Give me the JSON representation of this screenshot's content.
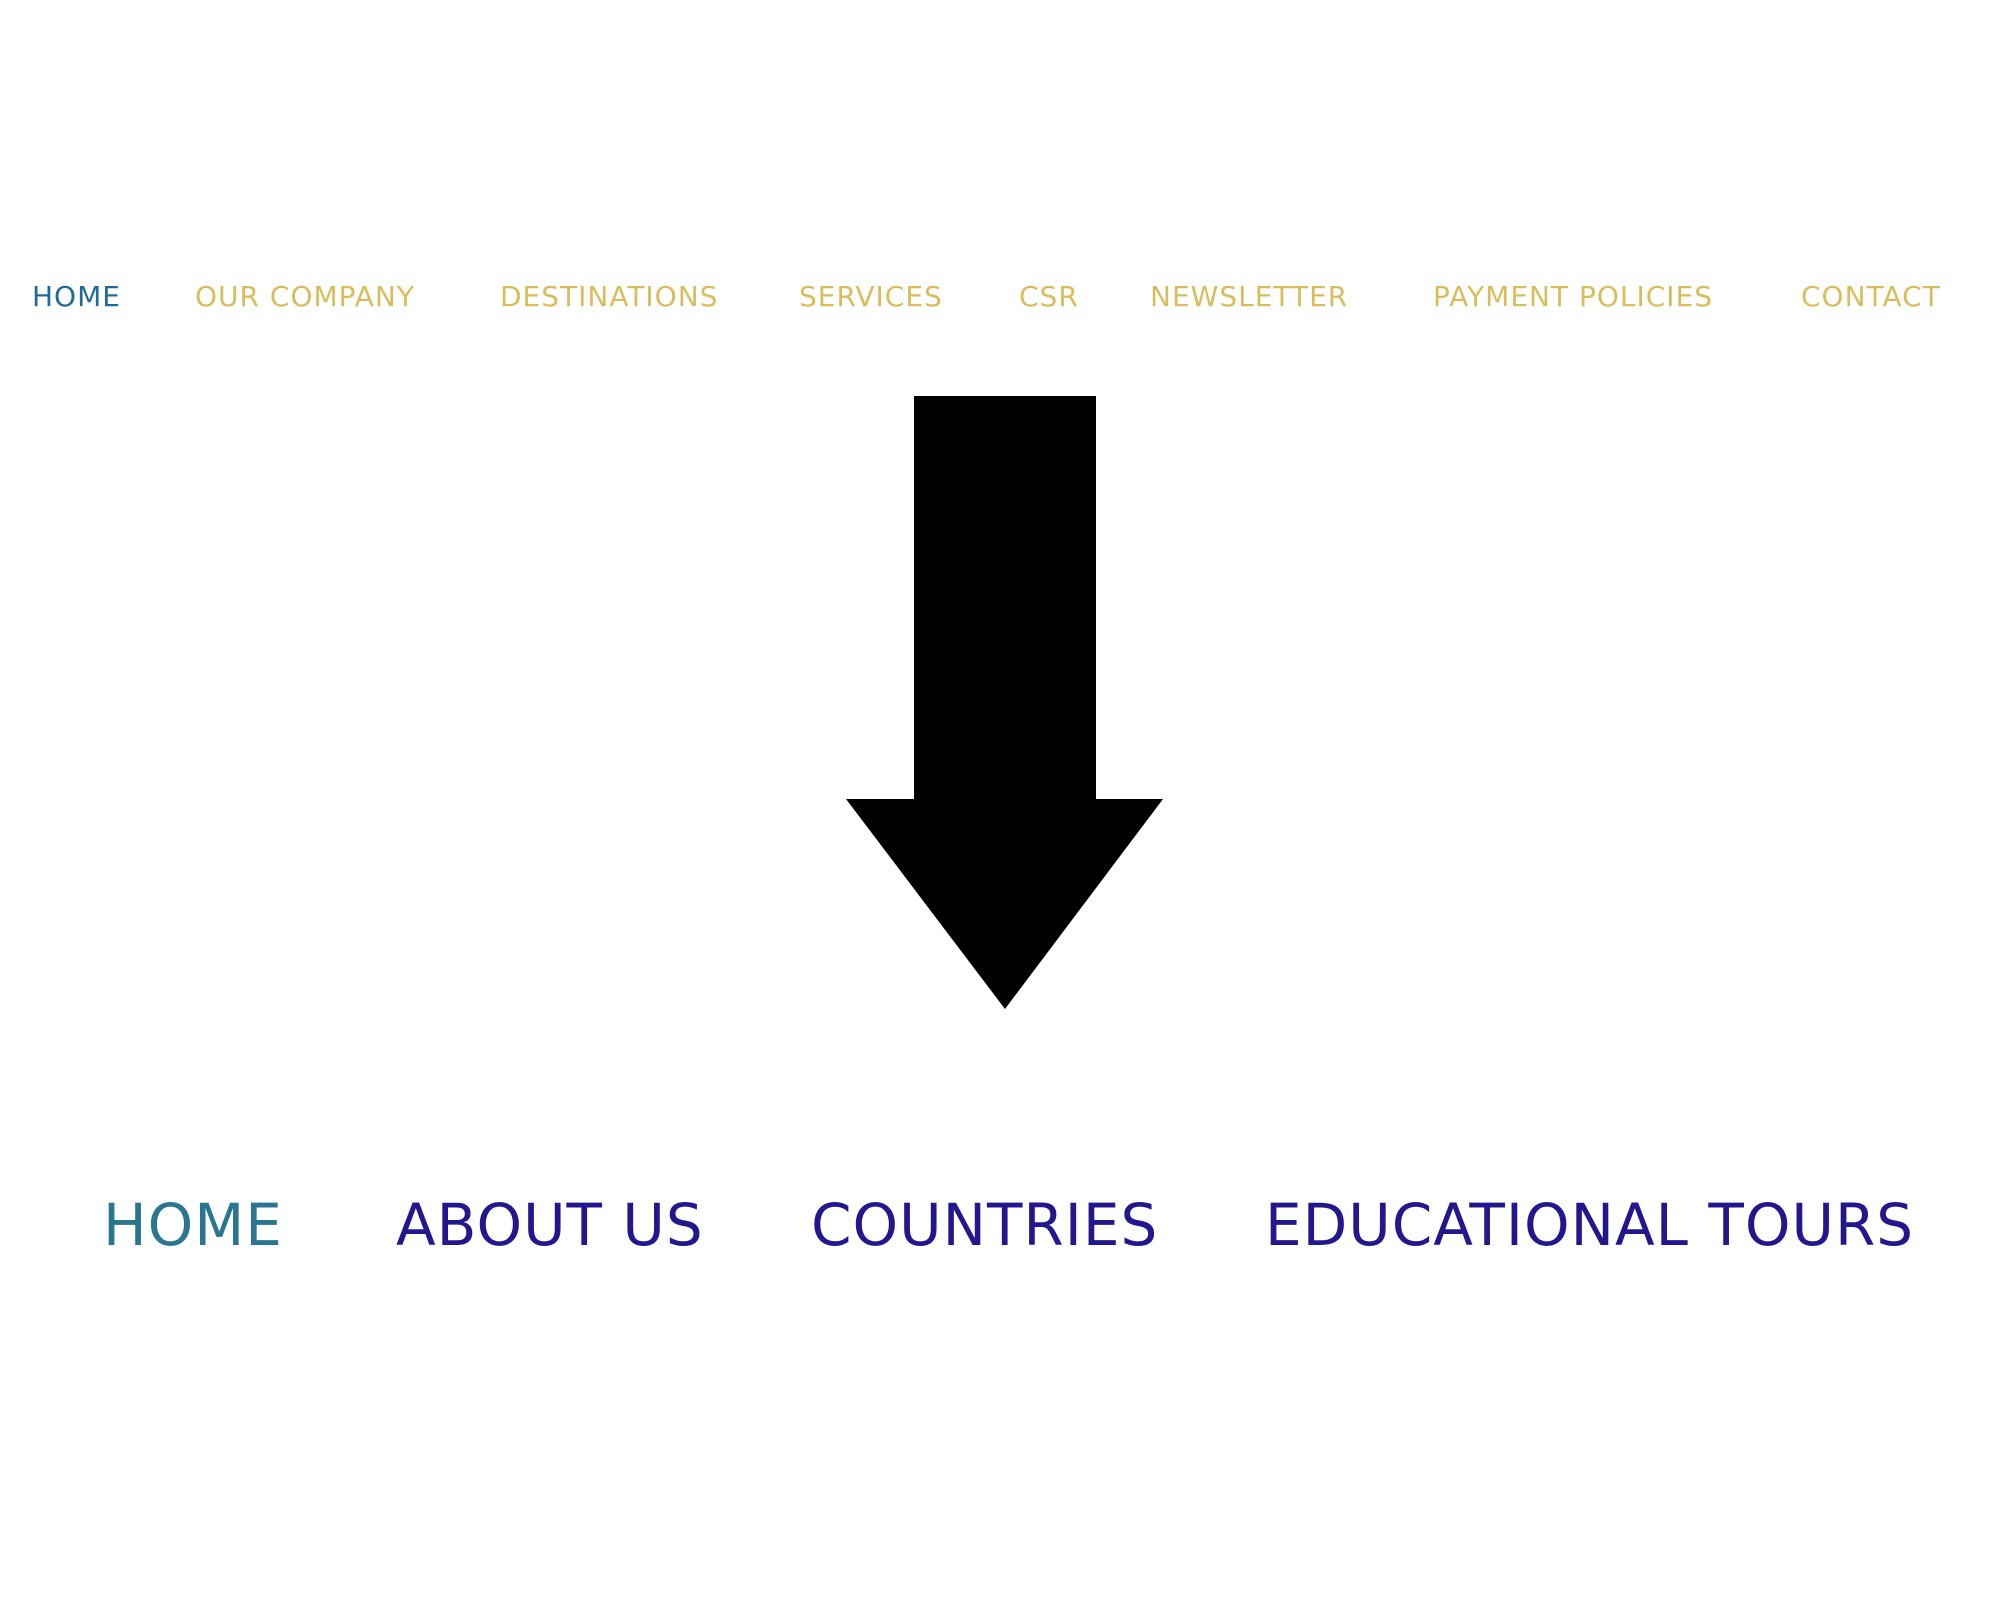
{
  "top_nav": {
    "items": [
      {
        "label": "HOME",
        "active": true
      },
      {
        "label": "OUR COMPANY"
      },
      {
        "label": "DESTINATIONS"
      },
      {
        "label": "SERVICES"
      },
      {
        "label": "CSR"
      },
      {
        "label": "NEWSLETTER"
      },
      {
        "label": "PAYMENT POLICIES"
      },
      {
        "label": "CONTACT"
      }
    ],
    "colors": {
      "active": "#1f6b94",
      "inactive": "#d9bd5c"
    }
  },
  "arrow": {
    "icon": "arrow-down-icon",
    "color": "#000000"
  },
  "bottom_nav": {
    "items": [
      {
        "label": "HOME",
        "active": true
      },
      {
        "label": "ABOUT US"
      },
      {
        "label": "COUNTRIES"
      },
      {
        "label": "EDUCATIONAL TOURS"
      }
    ],
    "colors": {
      "active": "#2a7590",
      "inactive": "#22178f"
    }
  }
}
